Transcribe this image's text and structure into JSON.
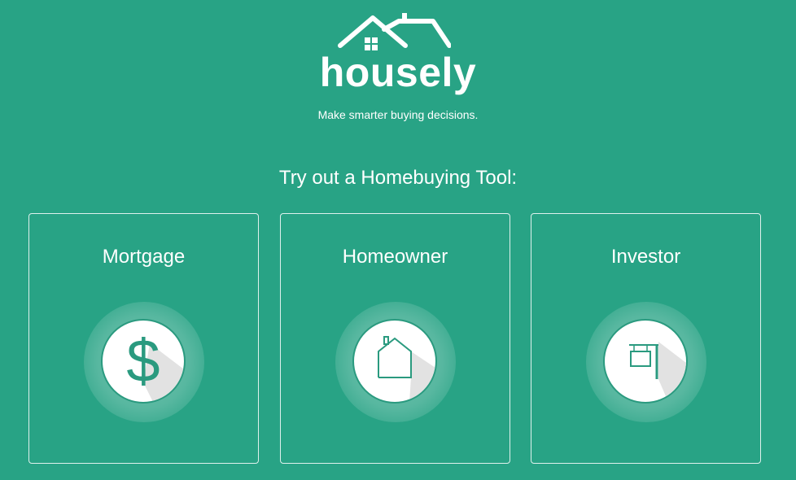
{
  "brand": {
    "name": "housely",
    "tagline": "Make smarter buying decisions."
  },
  "heading": "Try out a Homebuying Tool:",
  "tools": [
    {
      "title": "Mortgage",
      "icon": "dollar-icon",
      "glyph": "$"
    },
    {
      "title": "Homeowner",
      "icon": "house-icon"
    },
    {
      "title": "Investor",
      "icon": "for-sale-sign-icon"
    }
  ],
  "colors": {
    "background": "#28a385",
    "icon_stroke": "#2a9a7f",
    "text": "#ffffff"
  }
}
